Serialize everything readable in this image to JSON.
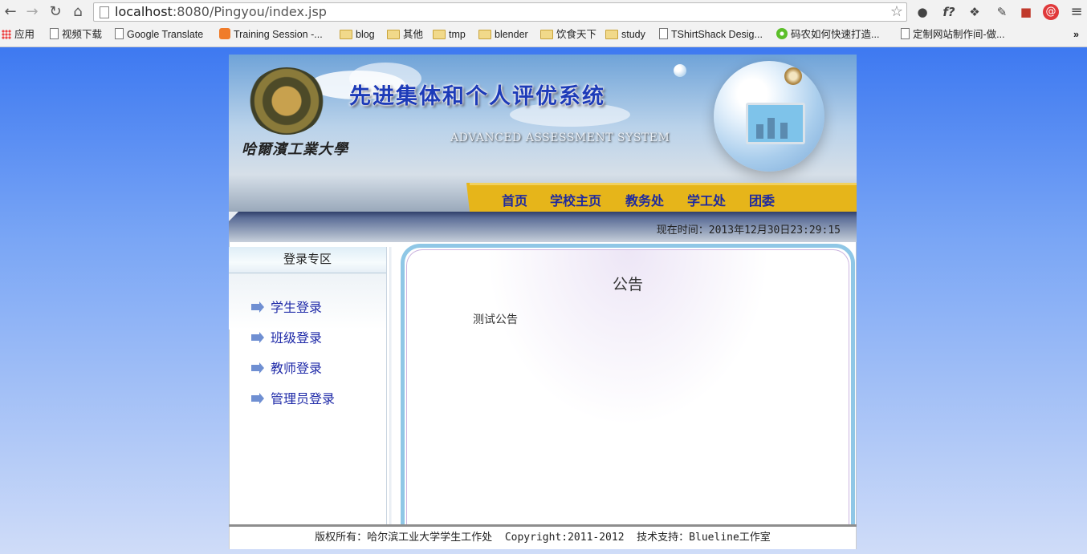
{
  "browser": {
    "url_host": "localhost",
    "url_path": ":8080/Pingyou/index.jsp",
    "bookmarks": [
      {
        "label": "应用",
        "icon": "apps-icon"
      },
      {
        "label": "视频下载",
        "icon": "page-icon"
      },
      {
        "label": "Google Translate",
        "icon": "page-icon"
      },
      {
        "label": "Training Session -...",
        "icon": "training-icon"
      },
      {
        "label": "blog",
        "icon": "folder-icon"
      },
      {
        "label": "其他",
        "icon": "folder-icon"
      },
      {
        "label": "tmp",
        "icon": "folder-icon"
      },
      {
        "label": "blender",
        "icon": "folder-icon"
      },
      {
        "label": "饮食天下",
        "icon": "folder-icon"
      },
      {
        "label": "study",
        "icon": "folder-icon"
      },
      {
        "label": "TShirtShack Desig...",
        "icon": "page-icon"
      },
      {
        "label": "码农如何快速打造...",
        "icon": "flower-icon"
      },
      {
        "label": "定制网站制作间-做...",
        "icon": "page-icon"
      }
    ],
    "more_bookmarks": "»"
  },
  "banner": {
    "school_name": "哈爾濱工業大學",
    "system_title": "先进集体和个人评优系统",
    "system_subtitle": "ADVANCED ASSESSMENT SYSTEM"
  },
  "nav": {
    "items": [
      "首页",
      "学校主页",
      "教务处",
      "学工处",
      "团委"
    ]
  },
  "status": {
    "time": "现在时间：2013年12月30日23:29:15"
  },
  "sidebar": {
    "title": "登录专区",
    "items": [
      "学生登录",
      "班级登录",
      "教师登录",
      "管理员登录"
    ]
  },
  "notice": {
    "title": "公告",
    "body": "测试公告"
  },
  "footer": {
    "text": "版权所有：哈尔滨工业大学学生工作处  Copyright:2011-2012  技术支持：Blueline工作室"
  },
  "colors": {
    "nav_bar": "#e6b51a",
    "nav_text": "#1f2a9e",
    "link_blue": "#1f2aa8",
    "page_bg": "#2f6ef0"
  }
}
